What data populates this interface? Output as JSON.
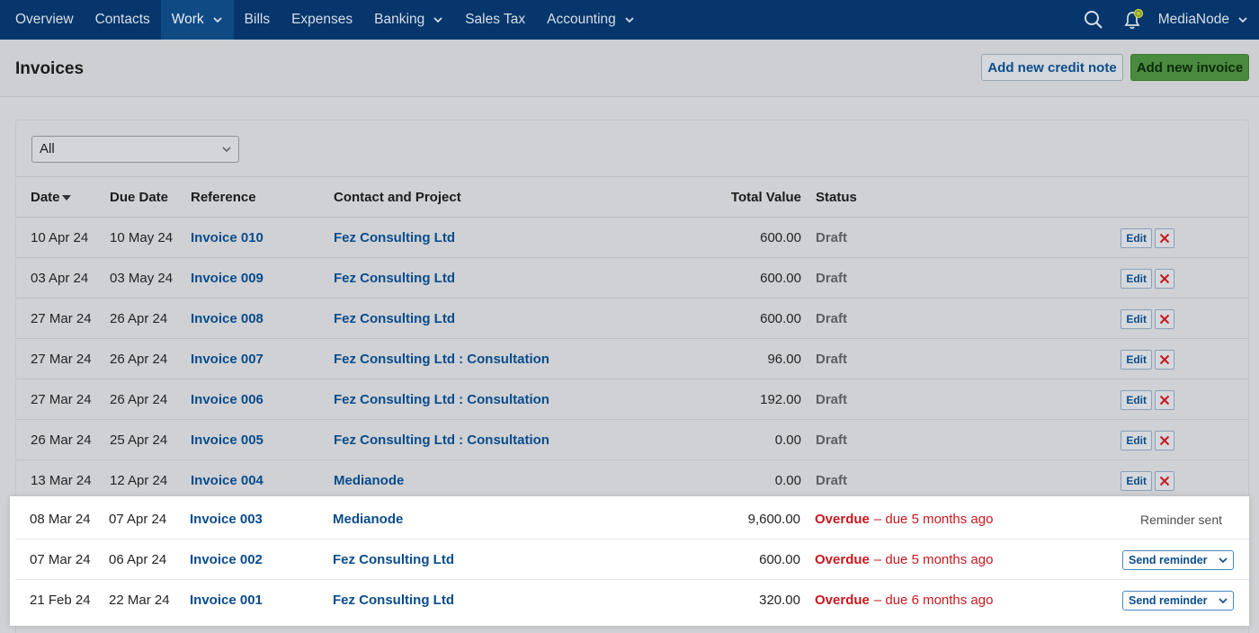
{
  "nav": {
    "items": [
      {
        "label": "Overview",
        "dropdown": false
      },
      {
        "label": "Contacts",
        "dropdown": false
      },
      {
        "label": "Work",
        "dropdown": true,
        "active": true
      },
      {
        "label": "Bills",
        "dropdown": false
      },
      {
        "label": "Expenses",
        "dropdown": false
      },
      {
        "label": "Banking",
        "dropdown": true
      },
      {
        "label": "Sales Tax",
        "dropdown": false
      },
      {
        "label": "Accounting",
        "dropdown": true
      }
    ],
    "brand": "MediaNode",
    "icons": [
      "search-icon",
      "bell-icon"
    ]
  },
  "header": {
    "title": "Invoices",
    "credit_note_label": "Add new credit note",
    "new_invoice_label": "Add new invoice"
  },
  "filter": {
    "selected": "All"
  },
  "table": {
    "columns": [
      "Date",
      "Due Date",
      "Reference",
      "Contact and Project",
      "Total Value",
      "Status"
    ],
    "sort_column": "Date",
    "rows": [
      {
        "date": "10 Apr 24",
        "due": "10 May 24",
        "ref": "Invoice 010",
        "contact": "Fez Consulting Ltd",
        "total": "600.00",
        "status": "Draft"
      },
      {
        "date": "03 Apr 24",
        "due": "03 May 24",
        "ref": "Invoice 009",
        "contact": "Fez Consulting Ltd",
        "total": "600.00",
        "status": "Draft"
      },
      {
        "date": "27 Mar 24",
        "due": "26 Apr 24",
        "ref": "Invoice 008",
        "contact": "Fez Consulting Ltd",
        "total": "600.00",
        "status": "Draft"
      },
      {
        "date": "27 Mar 24",
        "due": "26 Apr 24",
        "ref": "Invoice 007",
        "contact": "Fez Consulting Ltd : Consultation",
        "total": "96.00",
        "status": "Draft"
      },
      {
        "date": "27 Mar 24",
        "due": "26 Apr 24",
        "ref": "Invoice 006",
        "contact": "Fez Consulting Ltd : Consultation",
        "total": "192.00",
        "status": "Draft"
      },
      {
        "date": "26 Mar 24",
        "due": "25 Apr 24",
        "ref": "Invoice 005",
        "contact": "Fez Consulting Ltd : Consultation",
        "total": "0.00",
        "status": "Draft"
      },
      {
        "date": "13 Mar 24",
        "due": "12 Apr 24",
        "ref": "Invoice 004",
        "contact": "Medianode",
        "total": "0.00",
        "status": "Draft"
      }
    ],
    "overdue_rows": [
      {
        "date": "08 Mar 24",
        "due": "07 Apr 24",
        "ref": "Invoice 003",
        "contact": "Medianode",
        "total": "9,600.00",
        "status": "Overdue",
        "detail": "– due 5 months ago",
        "action": "Reminder sent"
      },
      {
        "date": "07 Mar 24",
        "due": "06 Apr 24",
        "ref": "Invoice 002",
        "contact": "Fez Consulting Ltd",
        "total": "600.00",
        "status": "Overdue",
        "detail": "– due 5 months ago",
        "action": "Send reminder"
      },
      {
        "date": "21 Feb 24",
        "due": "22 Mar 24",
        "ref": "Invoice 001",
        "contact": "Fez Consulting Ltd",
        "total": "320.00",
        "status": "Overdue",
        "detail": "– due 6 months ago",
        "action": "Send reminder"
      }
    ],
    "edit_label": "Edit"
  },
  "colors": {
    "nav_bg": "#06366b",
    "link": "#0a4c8c",
    "overdue": "#c8181e",
    "primary_button": "#4a8a3e"
  }
}
